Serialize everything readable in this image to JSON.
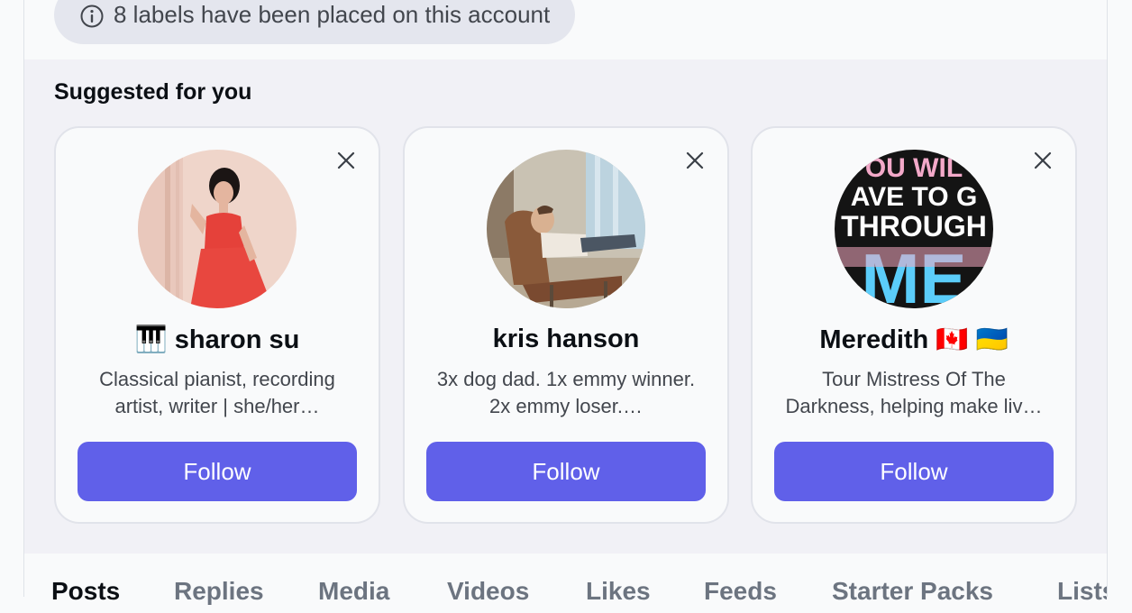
{
  "labels_notice": {
    "icon": "info-icon",
    "text": "8 labels have been placed on this account"
  },
  "suggested": {
    "title": "Suggested for you",
    "cards": [
      {
        "name": "🎹 sharon su",
        "bio": "Classical pianist, recording artist, writer | she/her…",
        "follow_label": "Follow",
        "avatar": "person-in-red-dress-photo"
      },
      {
        "name": "kris hanson",
        "bio": "3x dog dad. 1x emmy winner. 2x emmy loser.…",
        "follow_label": "Follow",
        "avatar": "man-on-lounge-chair-photo"
      },
      {
        "name": "Meredith 🇨🇦 🇺🇦",
        "bio": "Tour Mistress Of The Darkness, helping make liv…",
        "follow_label": "Follow",
        "avatar": "you-will-have-to-go-through-me-graphic",
        "avatar_text": [
          "OU WIL",
          "AVE TO G",
          "THROUGH",
          "ME"
        ]
      }
    ]
  },
  "tabs": [
    "Posts",
    "Replies",
    "Media",
    "Videos",
    "Likes",
    "Feeds",
    "Starter Packs",
    "Lists"
  ],
  "active_tab": "Posts",
  "colors": {
    "accent": "#6060e9",
    "section_bg": "#f1f1f6",
    "pill_bg": "#e4e6ee"
  }
}
